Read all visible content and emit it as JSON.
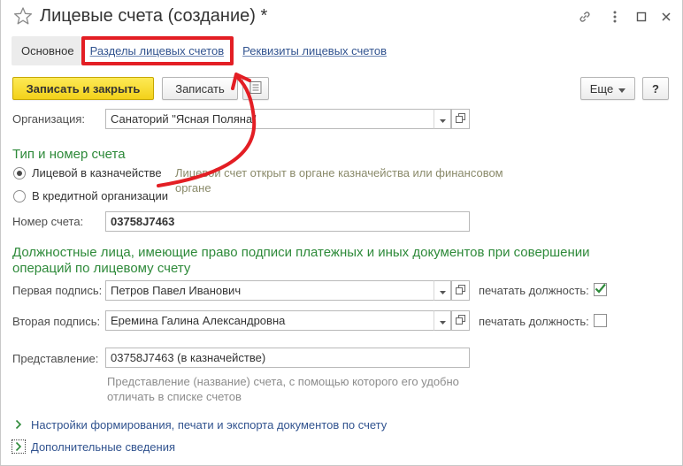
{
  "window": {
    "title": "Лицевые счета (создание) *"
  },
  "tabs": [
    {
      "label": "Основное",
      "active": true
    },
    {
      "label": "Разделы лицевых счетов",
      "active": false
    },
    {
      "label": "Реквизиты лицевых счетов",
      "active": false
    }
  ],
  "toolbar": {
    "save_close_label": "Записать и закрыть",
    "save_label": "Записать",
    "more_label": "Еще",
    "help_label": "?"
  },
  "organization": {
    "label": "Организация:",
    "value": "Санаторий \"Ясная Поляна\""
  },
  "account_type": {
    "title": "Тип и номер счета",
    "option_treasury": "Лицевой в казначействе",
    "option_credit": "В кредитной организации",
    "selected": "treasury",
    "hint_line1": "Лицевой счет открыт в органе казначейства или финансовом",
    "hint_line2": "органе",
    "number_label": "Номер счета:",
    "number_value": "03758J7463"
  },
  "signatures": {
    "title_line1": "Должностные лица, имеющие право подписи платежных и иных документов при совершении",
    "title_line2": "операций по лицевому счету",
    "first_label": "Первая подпись:",
    "first_value": "Петров Павел Иванович",
    "second_label": "Вторая подпись:",
    "second_value": "Еремина Галина Александровна",
    "print_position_label": "печатать должность:",
    "first_print_checked": true,
    "second_print_checked": false
  },
  "representation": {
    "label": "Представление:",
    "value": "03758J7463 (в казначействе)",
    "hint_line1": "Представление (название) счета, с помощью которого его удобно",
    "hint_line2": "отличать в списке счетов"
  },
  "groups": {
    "print_settings": "Настройки формирования, печати и экспорта документов по счету",
    "additional_info": "Дополнительные сведения"
  },
  "colors": {
    "accent_red": "#e31e24",
    "section_green": "#2e8a3a",
    "link_blue": "#31538f",
    "primary_yellow": "#f3d21a"
  }
}
